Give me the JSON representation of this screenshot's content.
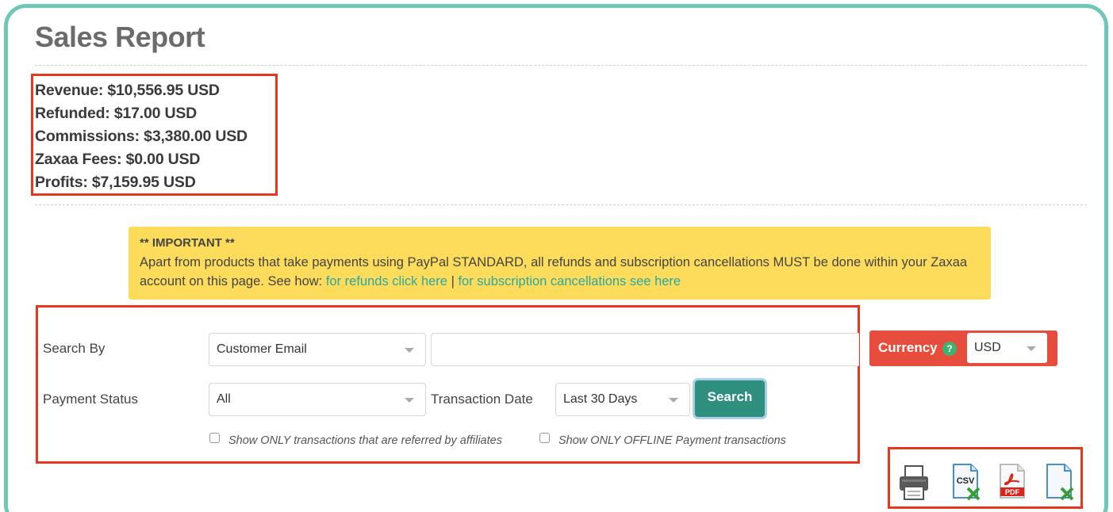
{
  "page": {
    "title": "Sales Report"
  },
  "summary": {
    "revenue": "Revenue: $10,556.95 USD",
    "refunded": "Refunded: $17.00 USD",
    "commissions": "Commissions: $3,380.00 USD",
    "fees": "Zaxaa Fees: $0.00 USD",
    "profits": "Profits: $7,159.95 USD"
  },
  "notice": {
    "heading": "** IMPORTANT **",
    "body": "Apart from products that take payments using PayPal STANDARD, all refunds and subscription cancellations MUST be done within your Zaxaa account on this page. See how: ",
    "refunds_link": "for refunds click here",
    "separator": " | ",
    "cancellations_link": "for subscription cancellations see here"
  },
  "search": {
    "search_by_label": "Search By",
    "search_by_value": "Customer Email",
    "search_text_value": "",
    "payment_status_label": "Payment Status",
    "payment_status_value": "All",
    "transaction_date_label": "Transaction Date",
    "transaction_date_value": "Last 30 Days",
    "search_button": "Search",
    "affiliate_checkbox_label": "Show ONLY transactions that are referred by affiliates",
    "offline_checkbox_label": "Show ONLY OFFLINE Payment transactions"
  },
  "currency": {
    "label": "Currency",
    "help": "?",
    "value": "USD"
  },
  "exports": {
    "csv_label": "CSV",
    "pdf_label": "PDF"
  },
  "colors": {
    "frame": "#6fc7b5",
    "highlight_border": "#e8371f",
    "notice_bg": "#fddc5c",
    "link": "#2aa8a0",
    "search_button": "#2f8f7e",
    "currency_bg": "#e74c3c"
  },
  "icons": [
    "printer-icon",
    "csv-export-icon",
    "pdf-export-icon",
    "excel-export-icon"
  ]
}
